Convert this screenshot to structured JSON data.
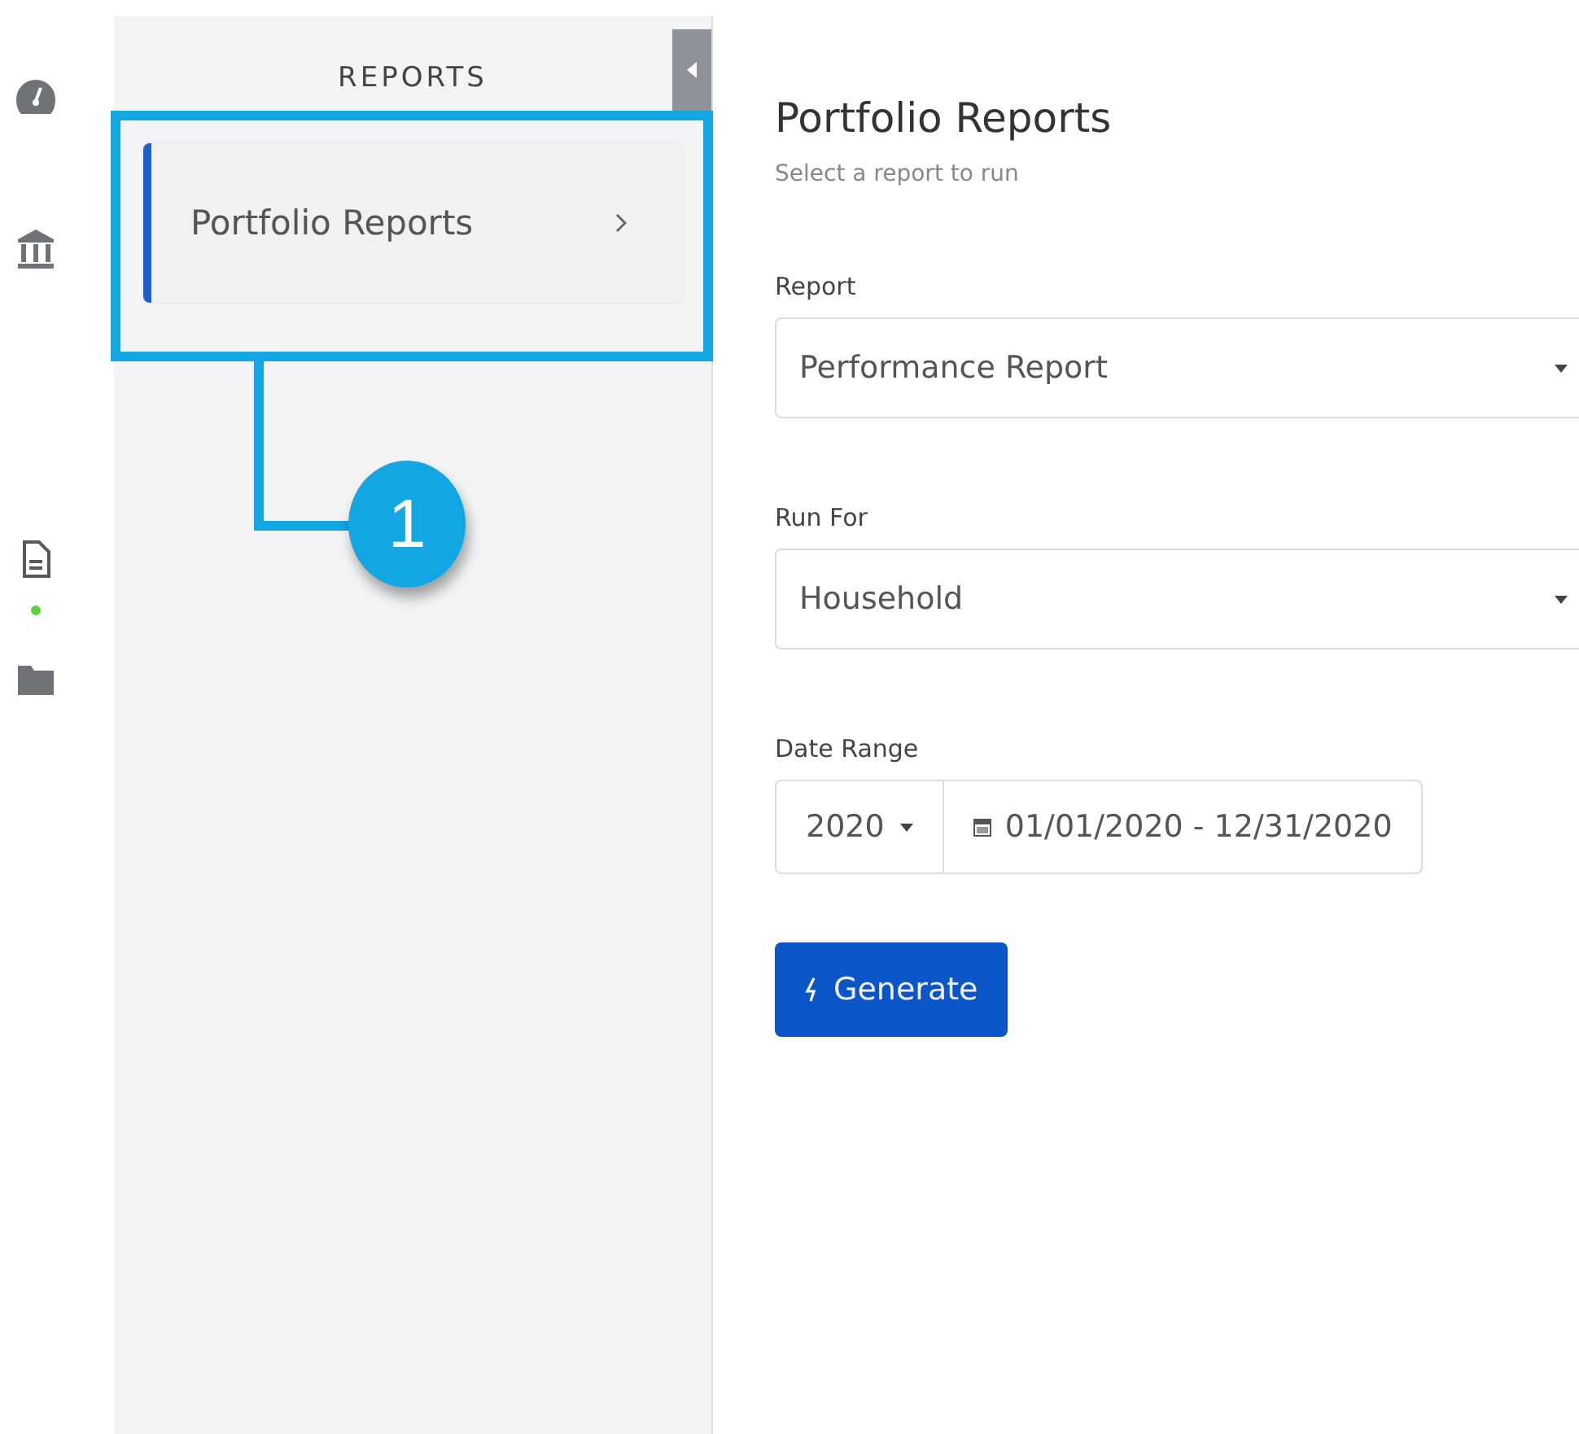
{
  "rail": [
    {
      "selected": false
    },
    {
      "selected": false
    },
    {
      "selected": true
    },
    {
      "selected": false
    }
  ],
  "sidebar": {
    "title": "REPORTS",
    "items": [
      {
        "label": "Portfolio Reports",
        "selected": true
      }
    ]
  },
  "main": {
    "title": "Portfolio Reports",
    "subtitle": "Select a report to run",
    "fields": [
      {
        "label": "Report",
        "value": "Performance Report"
      },
      {
        "label": "Run For",
        "value": "Household"
      }
    ],
    "date_range": {
      "label": "Date Range",
      "year": "2020",
      "range": "01/01/2020 - 12/31/2020"
    },
    "button": "Generate"
  },
  "callout": {
    "number": "1"
  }
}
